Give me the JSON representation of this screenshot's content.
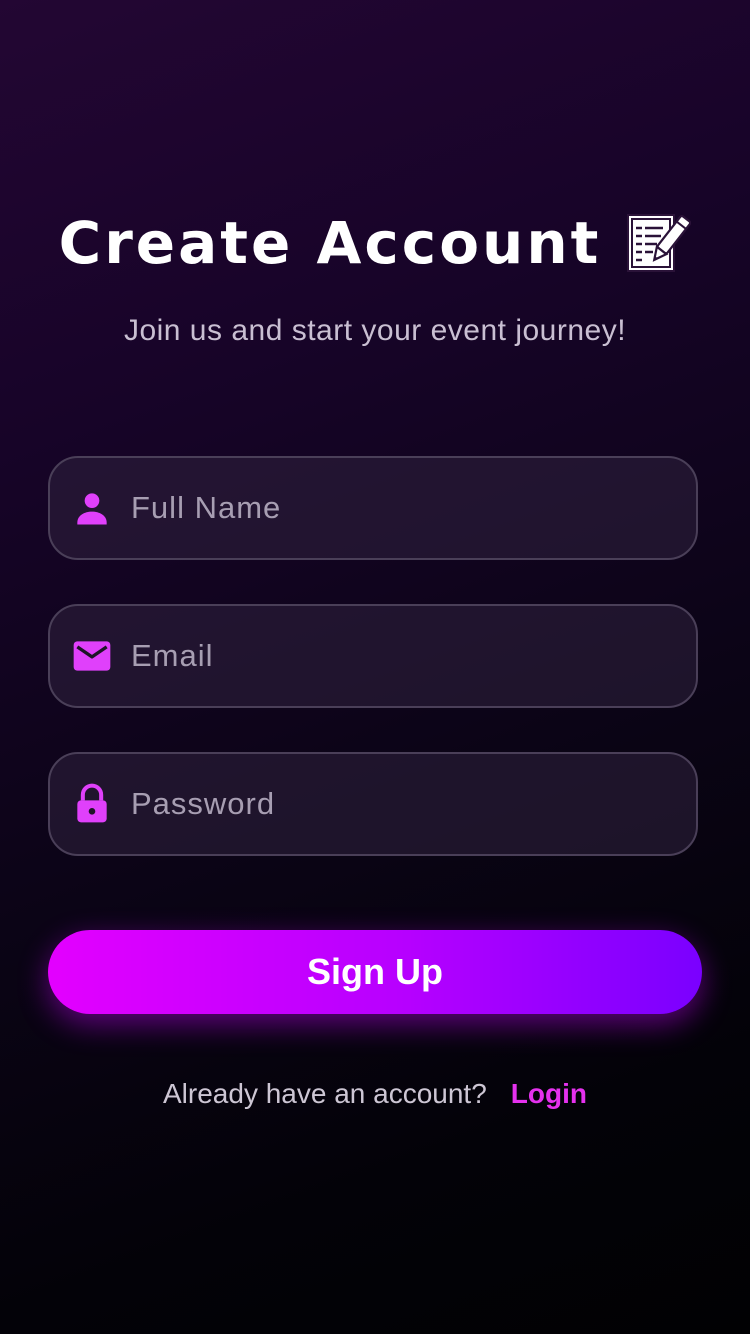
{
  "header": {
    "title": "Create Account",
    "title_icon": "memo-pencil-icon",
    "subtitle": "Join us and start your event journey!"
  },
  "form": {
    "full_name": {
      "placeholder": "Full Name",
      "value": "",
      "icon": "person-icon"
    },
    "email": {
      "placeholder": "Email",
      "value": "",
      "icon": "mail-icon"
    },
    "password": {
      "placeholder": "Password",
      "value": "",
      "icon": "lock-icon"
    },
    "signup_label": "Sign Up"
  },
  "footer": {
    "prompt": "Already have an account?",
    "login_label": "Login"
  },
  "colors": {
    "accent": "#e040fb",
    "button_gradient_start": "#e300ff",
    "button_gradient_end": "#7a00ff",
    "link": "#e531ee",
    "background_top": "#230633",
    "background_bottom": "#010103"
  }
}
